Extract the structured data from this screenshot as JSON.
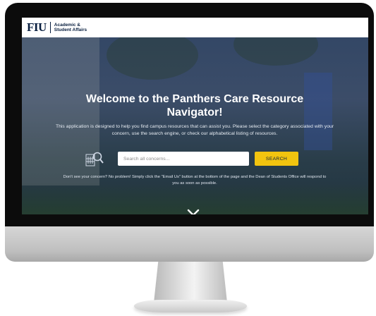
{
  "header": {
    "logo_mark": "FIU",
    "logo_line1": "Academic &",
    "logo_line2": "Student Affairs"
  },
  "hero": {
    "title": "Welcome to the Panthers Care Resource Navigator!",
    "description": "This application is designed to help you find campus resources that can assist you. Please select the category associated with your concern, use the search engine, or check our alphabetical listing of resources.",
    "search": {
      "placeholder": "Search all concerns...",
      "button_label": "SEARCH",
      "icon": "building-search-icon"
    },
    "note": "Don't see your concern? No problem! Simply click the \"Email Us\" button at the bottom of the page and the Dean of Students Office will respond to you as soon as possible.",
    "scroll_icon": "chevron-down-icon"
  },
  "colors": {
    "brand_navy": "#081e3f",
    "accent_gold": "#f2c40f",
    "overlay": "#162442"
  }
}
